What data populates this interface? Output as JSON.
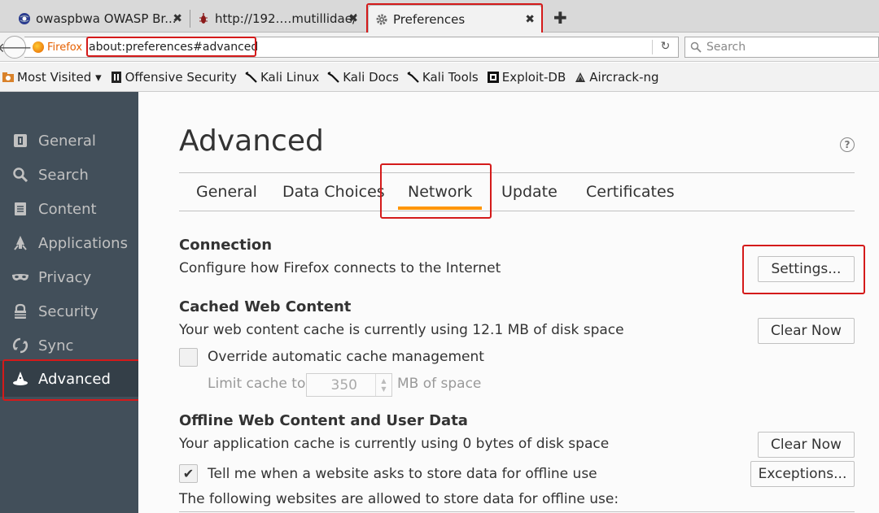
{
  "tabs": [
    {
      "title": "owaspbwa OWASP Br...",
      "icon": "globe-icon"
    },
    {
      "title": "http://192.…mutillidae/",
      "icon": "bug-icon"
    },
    {
      "title": "Preferences",
      "icon": "gear-icon",
      "active": true
    }
  ],
  "nav": {
    "identity": "Firefox",
    "url": "about:preferences#advanced",
    "search_placeholder": "Search"
  },
  "bookmarks": [
    {
      "label": "Most Visited ▾",
      "icon": "folder-icon"
    },
    {
      "label": "Offensive Security",
      "icon": "offsec-icon"
    },
    {
      "label": "Kali Linux",
      "icon": "kali-dragon-icon"
    },
    {
      "label": "Kali Docs",
      "icon": "kali-dragon-icon"
    },
    {
      "label": "Kali Tools",
      "icon": "kali-dragon-icon"
    },
    {
      "label": "Exploit-DB",
      "icon": "exploitdb-icon"
    },
    {
      "label": "Aircrack-ng",
      "icon": "aircrack-icon"
    }
  ],
  "sidebar": {
    "items": [
      {
        "label": "General",
        "icon": "general-icon"
      },
      {
        "label": "Search",
        "icon": "search-icon"
      },
      {
        "label": "Content",
        "icon": "content-icon"
      },
      {
        "label": "Applications",
        "icon": "applications-icon"
      },
      {
        "label": "Privacy",
        "icon": "mask-icon"
      },
      {
        "label": "Security",
        "icon": "lock-icon"
      },
      {
        "label": "Sync",
        "icon": "sync-icon"
      },
      {
        "label": "Advanced",
        "icon": "wizard-hat-icon",
        "active": true
      }
    ]
  },
  "main": {
    "title": "Advanced",
    "help": "?",
    "subtabs": [
      "General",
      "Data Choices",
      "Network",
      "Update",
      "Certificates"
    ],
    "active_subtab": "Network",
    "connection": {
      "heading": "Connection",
      "desc": "Configure how Firefox connects to the Internet",
      "button": "Settings..."
    },
    "cache": {
      "heading": "Cached Web Content",
      "desc": "Your web content cache is currently using 12.1 MB of disk space",
      "button": "Clear Now",
      "override_label": "Override automatic cache management",
      "override_checked": false,
      "limit_label": "Limit cache to",
      "limit_value": "350",
      "limit_unit": "MB of space"
    },
    "offline": {
      "heading": "Offline Web Content and User Data",
      "desc": "Your application cache is currently using 0 bytes of disk space",
      "button": "Clear Now",
      "tell_label": "Tell me when a website asks to store data for offline use",
      "tell_checked": true,
      "exceptions_button": "Exceptions...",
      "allowed_label": "The following websites are allowed to store data for offline use:"
    }
  },
  "colors": {
    "highlight": "#d41a1a",
    "active_tab_underline": "#ff9500",
    "sidebar_bg": "#424f5a",
    "sidebar_active_bg": "#343f48"
  }
}
